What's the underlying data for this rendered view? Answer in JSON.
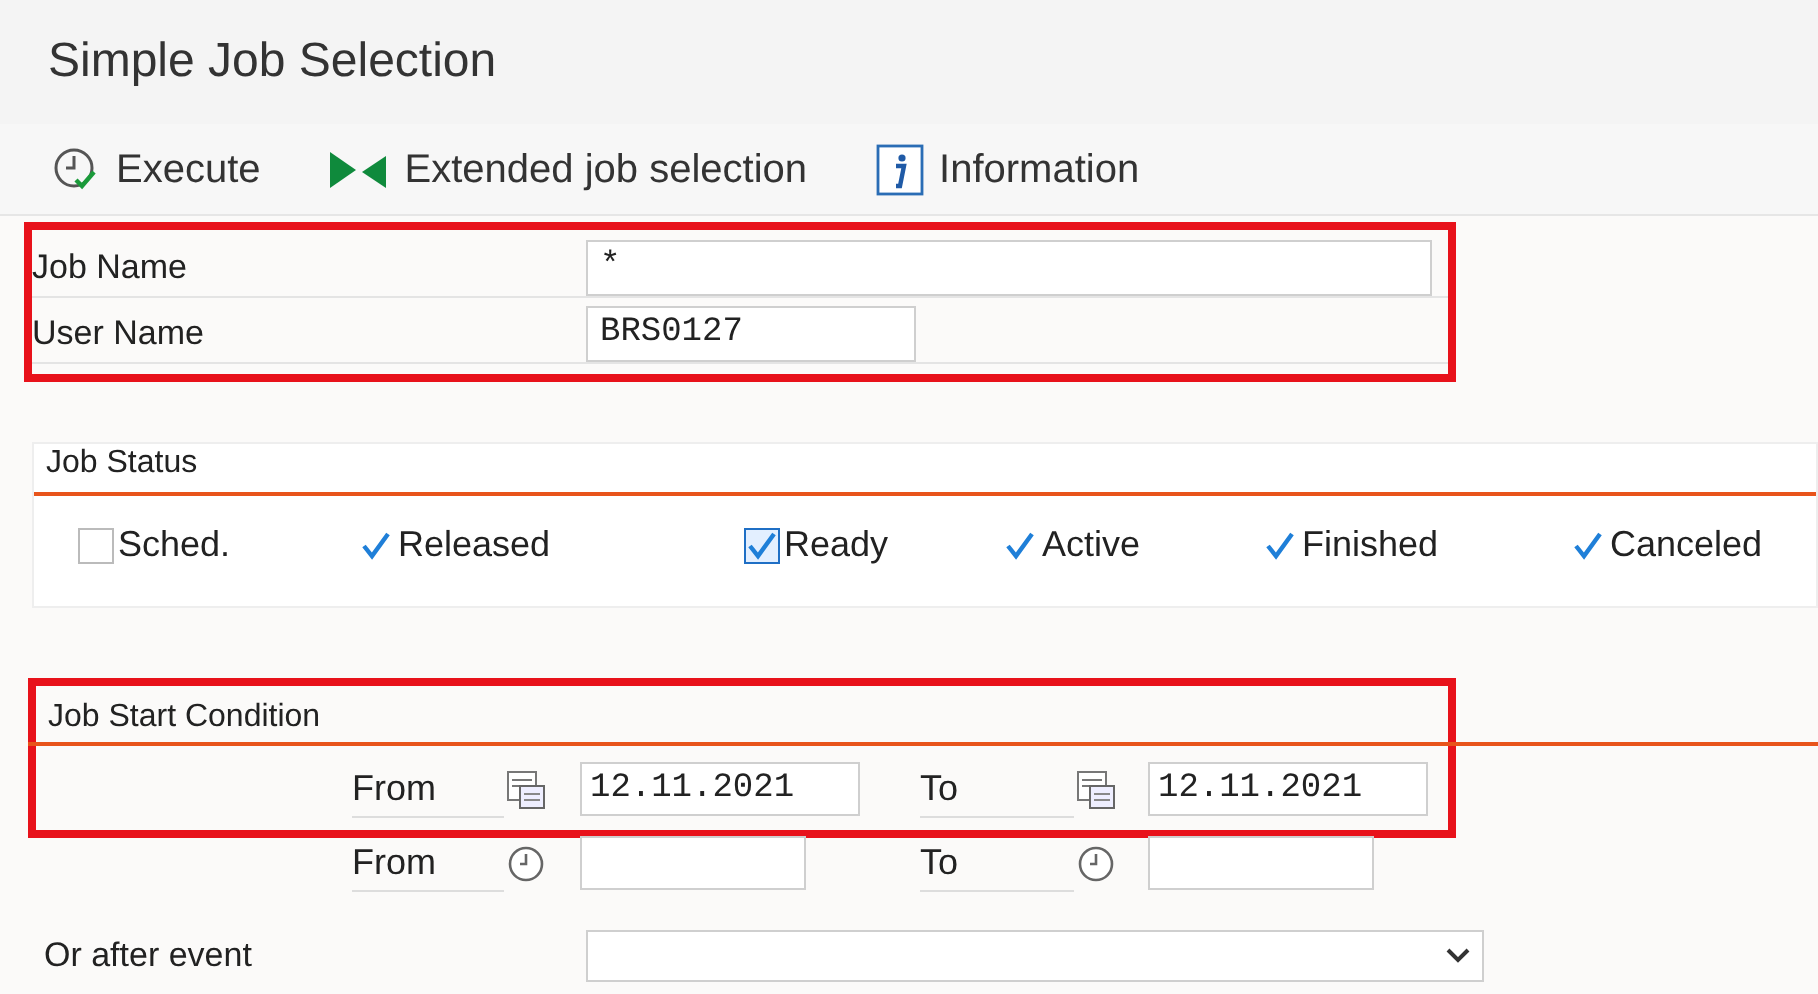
{
  "window": {
    "title": "Simple Job Selection"
  },
  "toolbar": [
    {
      "kind": "execute",
      "label": "Execute"
    },
    {
      "kind": "extended",
      "label": "Extended job selection"
    },
    {
      "kind": "info",
      "label": "Information"
    }
  ],
  "job_fields": [
    {
      "label": "Job Name",
      "value": "*",
      "wide": true
    },
    {
      "label": "User Name",
      "value": "BRS0127",
      "wide": false
    }
  ],
  "job_status": {
    "title": "Job Status",
    "options": [
      {
        "label": "Sched.",
        "checked": false,
        "focused": false
      },
      {
        "label": "Released",
        "checked": true,
        "focused": false
      },
      {
        "label": "Ready",
        "checked": true,
        "focused": true
      },
      {
        "label": "Active",
        "checked": true,
        "focused": false
      },
      {
        "label": "Finished",
        "checked": true,
        "focused": false
      },
      {
        "label": "Canceled",
        "checked": true,
        "focused": false
      }
    ]
  },
  "start_condition": {
    "title": "Job Start Condition",
    "rows": [
      {
        "kind": "date",
        "from_label": "From",
        "from_value": "12.11.2021",
        "to_label": "To",
        "to_value": "12.11.2021"
      },
      {
        "kind": "time",
        "from_label": "From",
        "to_label": "To"
      }
    ]
  },
  "event": {
    "label": "Or after event"
  }
}
